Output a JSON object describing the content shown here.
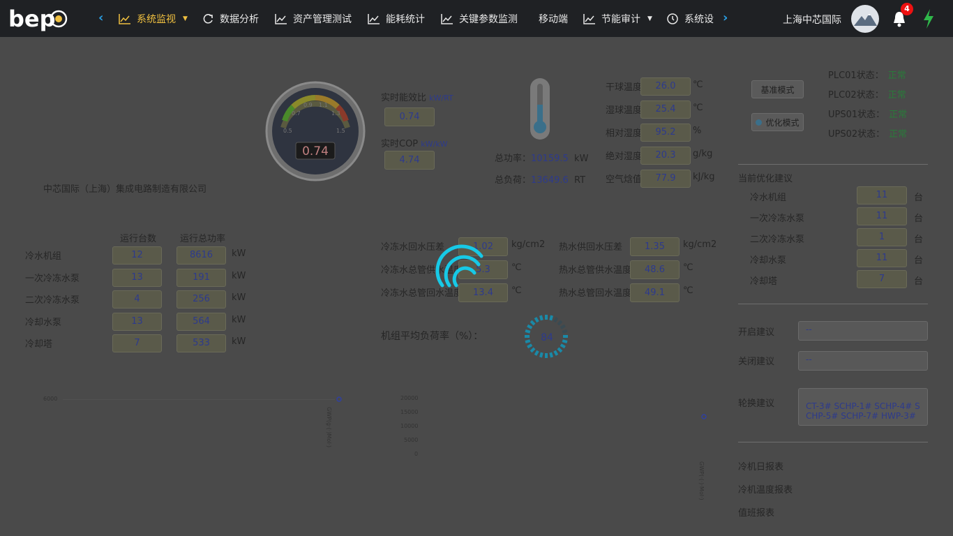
{
  "nav": {
    "logo": "bep",
    "items": [
      {
        "label": "系统监视",
        "icon": "chart-line-icon",
        "active": true,
        "caret": true
      },
      {
        "label": "数据分析",
        "icon": "refresh-icon"
      },
      {
        "label": "资产管理测试",
        "icon": "chart-line-icon"
      },
      {
        "label": "能耗统计",
        "icon": "chart-line-icon"
      },
      {
        "label": "关键参数监测",
        "icon": "chart-line-icon"
      },
      {
        "label": "移动端",
        "icon": ""
      },
      {
        "label": "节能审计",
        "icon": "chart-line-icon",
        "caret": true
      },
      {
        "label": "系统设",
        "icon": "clock-icon"
      }
    ],
    "user": "上海中芯国际",
    "notifications": "4"
  },
  "company": "中芯国际（上海）集成电路制造有限公司",
  "gauge": {
    "value": "0.74",
    "ticks": [
      "0.5",
      "0.7",
      "0.9",
      "1.1",
      "1.3",
      "1.5"
    ]
  },
  "efficiency": {
    "rt_label": "实时能效比",
    "rt_unit": "kW/RT",
    "rt_value": "0.74",
    "cop_label": "实时COP",
    "cop_unit": "kW/kW",
    "cop_value": "4.74"
  },
  "power": {
    "total_power_label": "总功率：",
    "total_power": "10159.5",
    "total_power_unit": "kW",
    "total_load_label": "总负荷：",
    "total_load": "13649.6",
    "total_load_unit": "RT"
  },
  "weather": [
    {
      "label": "干球温度",
      "value": "26.0",
      "unit": "℃"
    },
    {
      "label": "湿球温度",
      "value": "25.4",
      "unit": "℃"
    },
    {
      "label": "相对湿度",
      "value": "95.2",
      "unit": "%"
    },
    {
      "label": "绝对湿度",
      "value": "20.3",
      "unit": "g/kg"
    },
    {
      "label": "空气焓值",
      "value": "77.9",
      "unit": "kJ/kg"
    }
  ],
  "equipment": {
    "col_count": "运行台数",
    "col_power": "运行总功率",
    "rows": [
      {
        "name": "冷水机组",
        "count": "12",
        "power": "8616",
        "unit": "kW"
      },
      {
        "name": "一次冷冻水泵",
        "count": "13",
        "power": "191",
        "unit": "kW"
      },
      {
        "name": "二次冷冻水泵",
        "count": "4",
        "power": "256",
        "unit": "kW"
      },
      {
        "name": "冷却水泵",
        "count": "13",
        "power": "564",
        "unit": "kW"
      },
      {
        "name": "冷却塔",
        "count": "7",
        "power": "533",
        "unit": "kW"
      }
    ]
  },
  "pipes_left": [
    {
      "label": "冷冻水回水压差",
      "value": "1.02",
      "unit": "kg/cm2"
    },
    {
      "label": "冷冻水总管供水温度",
      "value": "5.3",
      "unit": "℃"
    },
    {
      "label": "冷冻水总管回水温度",
      "value": "13.4",
      "unit": "℃"
    }
  ],
  "pipes_right": [
    {
      "label": "热水供回水压差",
      "value": "1.35",
      "unit": "kg/cm2"
    },
    {
      "label": "热水总管供水温度",
      "value": "48.6",
      "unit": "℃"
    },
    {
      "label": "热水总管回水温度",
      "value": "49.1",
      "unit": "℃"
    }
  ],
  "avg_load": {
    "label": "机组平均负荷率（%）：",
    "value": "84"
  },
  "modes": {
    "base": "基准模式",
    "optimized": "优化模式"
  },
  "plc": [
    {
      "label": "PLC01状态：",
      "status": "正常"
    },
    {
      "label": "PLC02状态：",
      "status": "正常"
    },
    {
      "label": "UPS01状态：",
      "status": "正常"
    },
    {
      "label": "UPS02状态：",
      "status": "正常"
    }
  ],
  "suggestion": {
    "title": "当前优化建议",
    "unit": "台",
    "rows": [
      {
        "name": "冷水机组",
        "value": "11"
      },
      {
        "name": "一次冷冻水泵",
        "value": "11"
      },
      {
        "name": "二次冷冻水泵",
        "value": "1"
      },
      {
        "name": "冷却水泵",
        "value": "11"
      },
      {
        "name": "冷却塔",
        "value": "7"
      }
    ]
  },
  "advice": {
    "open_label": "开启建议",
    "open_value": "--",
    "close_label": "关闭建议",
    "close_value": "--",
    "rotate_label": "轮换建议",
    "rotate_value": "CT-3# SCHP-1# SCHP-4# SCHP-5# SCHP-7# HWP-3#"
  },
  "reports": [
    "冷机日报表",
    "冷机温度报表",
    "值班报表"
  ],
  "mini_chart_left": {
    "tick": "6000",
    "ylabel": "GWP(g·(·)Mol·)"
  },
  "mini_chart_mid": {
    "ticks": [
      "20000",
      "15000",
      "10000",
      "5000",
      "0"
    ]
  },
  "mini_chart_right": {
    "ylabel": "GWP(·(·)·Mol·)"
  }
}
